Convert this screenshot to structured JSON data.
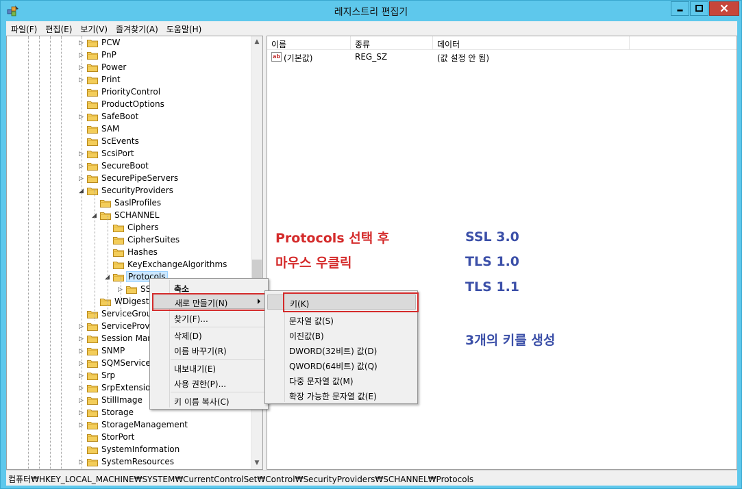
{
  "window": {
    "title": "레지스트리 편집기",
    "colors": {
      "titlebar": "#5ec8ec",
      "close": "#c7463a",
      "selection": "#cce8ff",
      "annotation_red": "#d42a2a",
      "annotation_blue": "#3b4fa8"
    }
  },
  "menu": [
    {
      "label": "파일(F)"
    },
    {
      "label": "편집(E)"
    },
    {
      "label": "보기(V)"
    },
    {
      "label": "즐겨찾기(A)"
    },
    {
      "label": "도움말(H)"
    }
  ],
  "tree": [
    {
      "label": "PCW",
      "level": 0,
      "expander": "collapsed"
    },
    {
      "label": "PnP",
      "level": 0,
      "expander": "collapsed"
    },
    {
      "label": "Power",
      "level": 0,
      "expander": "collapsed"
    },
    {
      "label": "Print",
      "level": 0,
      "expander": "collapsed"
    },
    {
      "label": "PriorityControl",
      "level": 0,
      "expander": "none"
    },
    {
      "label": "ProductOptions",
      "level": 0,
      "expander": "none"
    },
    {
      "label": "SafeBoot",
      "level": 0,
      "expander": "collapsed"
    },
    {
      "label": "SAM",
      "level": 0,
      "expander": "none"
    },
    {
      "label": "ScEvents",
      "level": 0,
      "expander": "none"
    },
    {
      "label": "ScsiPort",
      "level": 0,
      "expander": "collapsed"
    },
    {
      "label": "SecureBoot",
      "level": 0,
      "expander": "collapsed"
    },
    {
      "label": "SecurePipeServers",
      "level": 0,
      "expander": "collapsed"
    },
    {
      "label": "SecurityProviders",
      "level": 0,
      "expander": "expanded"
    },
    {
      "label": "SaslProfiles",
      "level": 1,
      "expander": "none"
    },
    {
      "label": "SCHANNEL",
      "level": 1,
      "expander": "expanded"
    },
    {
      "label": "Ciphers",
      "level": 2,
      "expander": "none"
    },
    {
      "label": "CipherSuites",
      "level": 2,
      "expander": "none"
    },
    {
      "label": "Hashes",
      "level": 2,
      "expander": "none"
    },
    {
      "label": "KeyExchangeAlgorithms",
      "level": 2,
      "expander": "none"
    },
    {
      "label": "Protocols",
      "level": 2,
      "expander": "expanded",
      "selected": true
    },
    {
      "label": "SS",
      "level": 3,
      "expander": "collapsed"
    },
    {
      "label": "WDigest",
      "level": 1,
      "expander": "none"
    },
    {
      "label": "ServiceGroup",
      "level": 0,
      "expander": "none"
    },
    {
      "label": "ServiceProvic",
      "level": 0,
      "expander": "collapsed"
    },
    {
      "label": "Session Mana",
      "level": 0,
      "expander": "collapsed"
    },
    {
      "label": "SNMP",
      "level": 0,
      "expander": "collapsed"
    },
    {
      "label": "SQMServiceL",
      "level": 0,
      "expander": "collapsed"
    },
    {
      "label": "Srp",
      "level": 0,
      "expander": "collapsed"
    },
    {
      "label": "SrpExtension",
      "level": 0,
      "expander": "collapsed"
    },
    {
      "label": "StillImage",
      "level": 0,
      "expander": "collapsed"
    },
    {
      "label": "Storage",
      "level": 0,
      "expander": "collapsed"
    },
    {
      "label": "StorageManagement",
      "level": 0,
      "expander": "collapsed"
    },
    {
      "label": "StorPort",
      "level": 0,
      "expander": "none"
    },
    {
      "label": "SystemInformation",
      "level": 0,
      "expander": "none"
    },
    {
      "label": "SystemResources",
      "level": 0,
      "expander": "collapsed"
    }
  ],
  "list": {
    "columns": [
      "이름",
      "종류",
      "데이터"
    ],
    "rows": [
      {
        "name": "(기본값)",
        "type": "REG_SZ",
        "data": "(값 설정 안 됨)",
        "icon": "ab"
      }
    ]
  },
  "context_menu": {
    "items": [
      {
        "label": "축소",
        "bold": true
      },
      {
        "label": "새로 만들기(N)",
        "submenu": true,
        "highlighted": true
      },
      {
        "label": "찾기(F)..."
      },
      {
        "label": "삭제(D)"
      },
      {
        "label": "이름 바꾸기(R)"
      },
      {
        "label": "내보내기(E)"
      },
      {
        "label": "사용 권한(P)..."
      },
      {
        "label": "키 이름 복사(C)"
      }
    ]
  },
  "submenu": {
    "items": [
      {
        "label": "키(K)",
        "highlighted": true
      },
      {
        "label": "문자열 값(S)"
      },
      {
        "label": "이진값(B)"
      },
      {
        "label": "DWORD(32비트) 값(D)"
      },
      {
        "label": "QWORD(64비트) 값(Q)"
      },
      {
        "label": "다중 문자열 값(M)"
      },
      {
        "label": "확장 가능한 문자열 값(E)"
      }
    ]
  },
  "annotations": {
    "red_line1": "Protocols 선택 후",
    "red_line2": "마우스 우클릭",
    "blue_ssl30": "SSL 3.0",
    "blue_tls10": "TLS 1.0",
    "blue_tls11": "TLS 1.1",
    "blue_create": "3개의 키를 생성"
  },
  "statusbar": {
    "path": "컴퓨터₩HKEY_LOCAL_MACHINE₩SYSTEM₩CurrentControlSet₩Control₩SecurityProviders₩SCHANNEL₩Protocols"
  }
}
